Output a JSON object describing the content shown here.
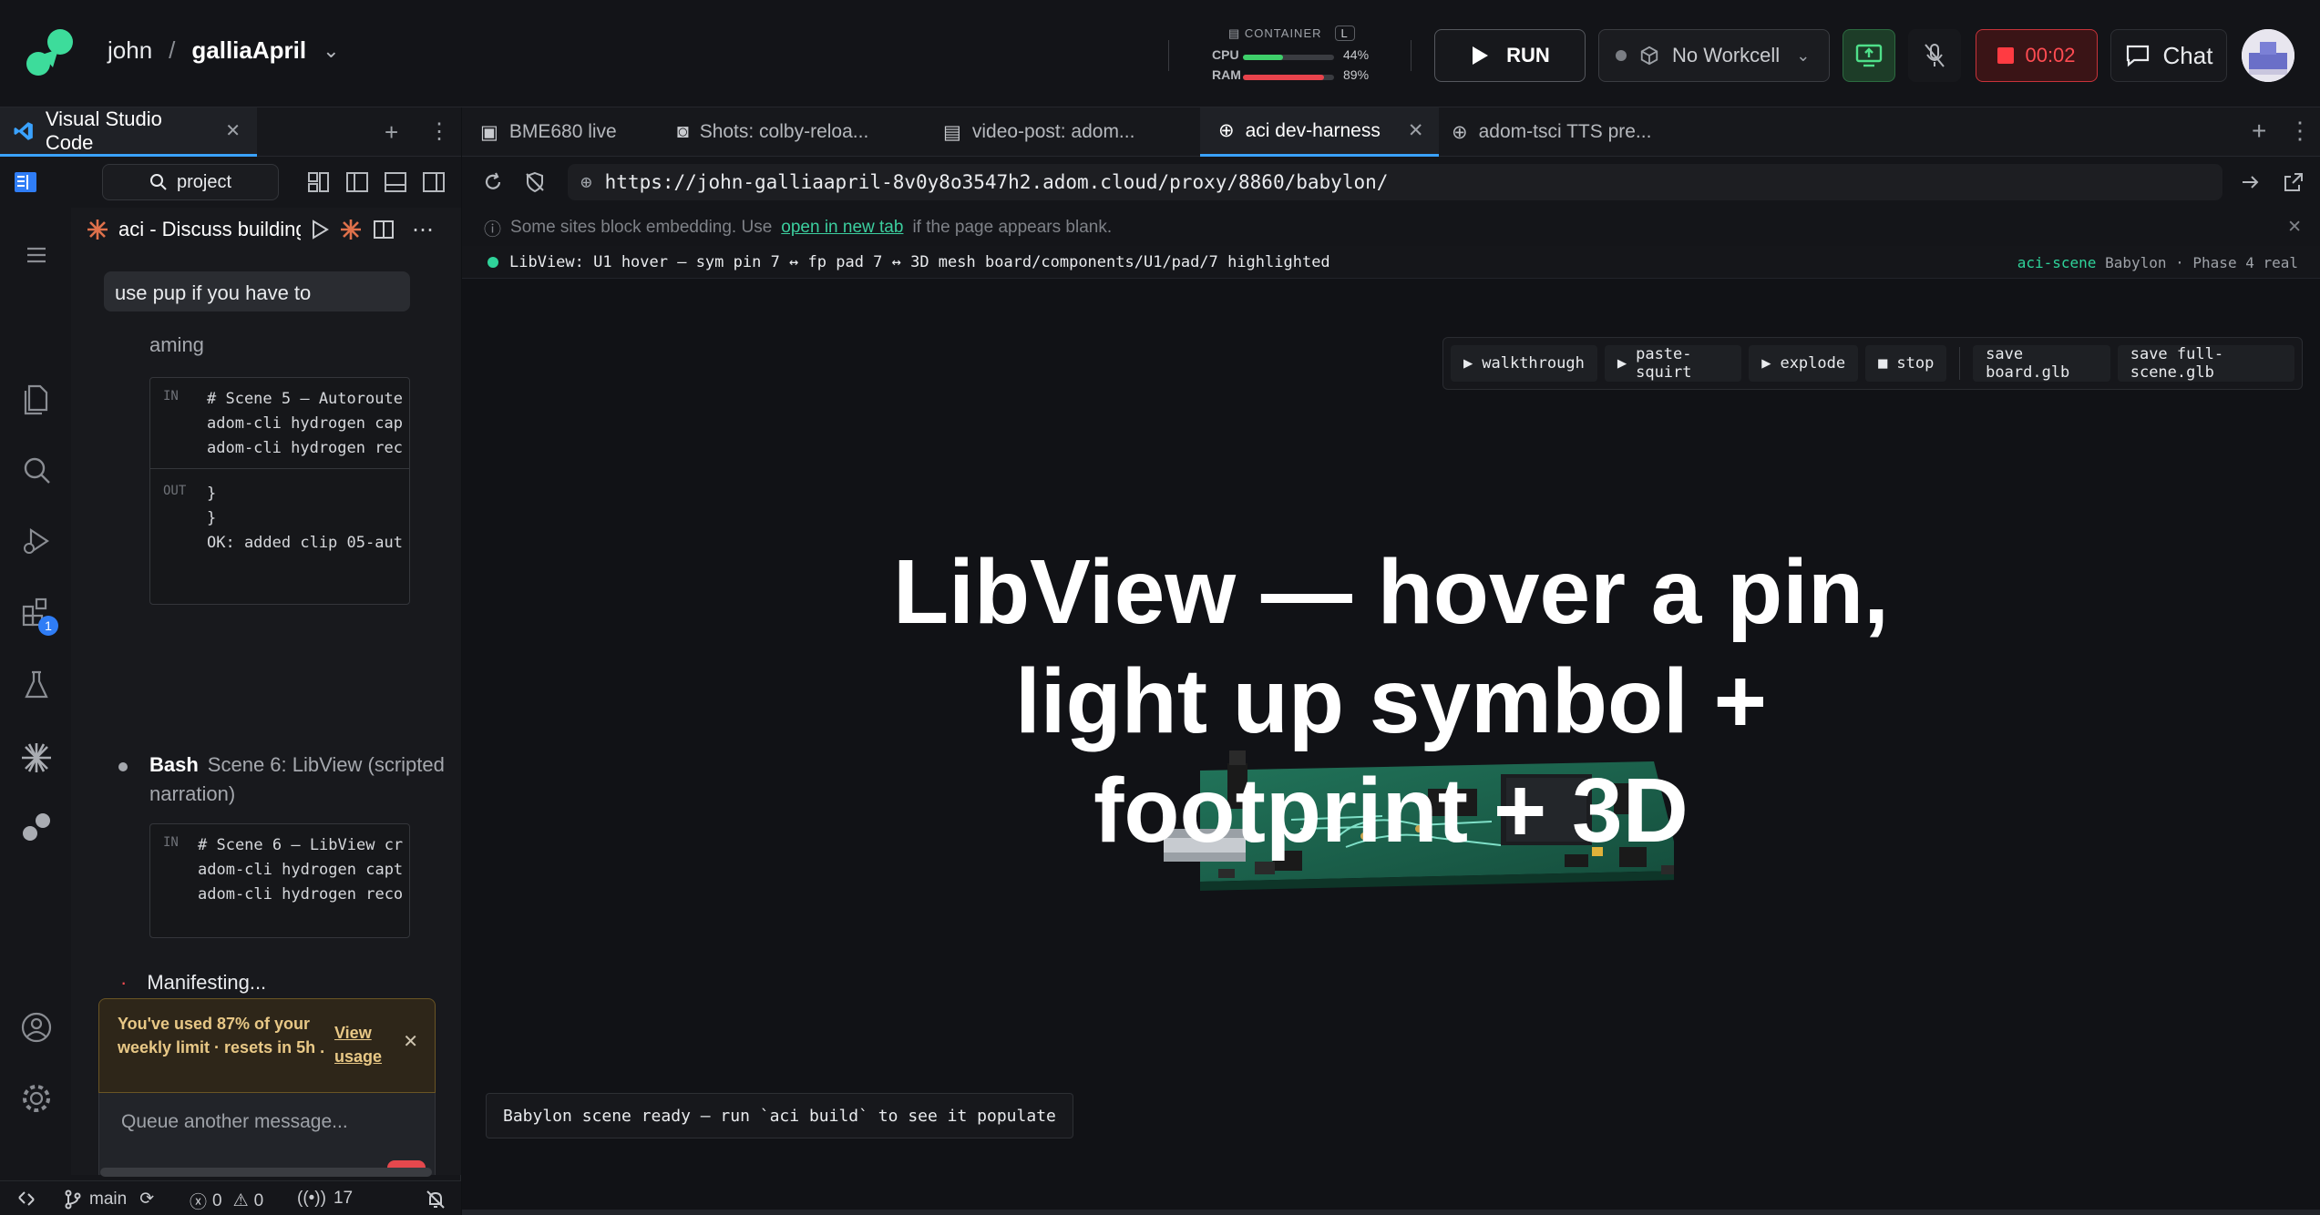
{
  "topbar": {
    "user": "john",
    "separator": "/",
    "project": "galliaApril",
    "resources": {
      "header": "CONTAINER",
      "size_badge": "L",
      "cpu_label": "CPU",
      "cpu_pct": "44%",
      "cpu_value": 44,
      "ram_label": "RAM",
      "ram_pct": "89%",
      "ram_value": 89
    },
    "run_label": "RUN",
    "workcell_label": "No Workcell",
    "timer": "00:02",
    "chat_label": "Chat"
  },
  "left": {
    "tab_label": "Visual Studio Code",
    "search_label": "project",
    "activity_badge": "1",
    "chat_title": "aci - Discuss building",
    "user_message": "use pup if you have to",
    "thinking_label": "aming",
    "code1": {
      "in_tag": "IN",
      "in_lines": "# Scene 5 — Autoroute\nadom-cli hydrogen cap\nadom-cli hydrogen rec",
      "out_tag": "OUT",
      "out_lines": "}\n}\nOK: added clip 05-aut"
    },
    "bash_tool": "Bash",
    "bash_desc": "Scene 6: LibView (scripted narration)",
    "code2": {
      "in_tag": "IN",
      "in_lines": "# Scene 6 — LibView cr\nadom-cli hydrogen capt\nadom-cli hydrogen reco"
    },
    "status_text": "Manifesting...",
    "limit_notice": "You've used 87% of your weekly limit · resets in 5h .",
    "limit_link": "View usage",
    "composer_placeholder": "Queue another message...",
    "statusbar": {
      "branch": "main",
      "errors": "0",
      "warnings": "0",
      "ports": "17"
    }
  },
  "browser": {
    "tabs": [
      {
        "label": "BME680 live"
      },
      {
        "label": "Shots: colby-reloa..."
      },
      {
        "label": "video-post: adom..."
      },
      {
        "label": "aci dev-harness"
      },
      {
        "label": "adom-tsci TTS pre..."
      }
    ],
    "url": "https://john-galliaapril-8v0y8o3547h2.adom.cloud/proxy/8860/babylon/",
    "notice_pre": "Some sites block embedding. Use",
    "notice_link": "open in new tab",
    "notice_post": "if the page appears blank.",
    "libview_status": "LibView: U1 hover — sym pin 7 ↔ fp pad 7 ↔ 3D mesh board/components/U1/pad/7 highlighted",
    "scene_tag": "aci-scene",
    "scene_info": "Babylon · Phase 4 real",
    "tools": {
      "walkthrough": "walkthrough",
      "paste_squirt": "paste-squirt",
      "explode": "explode",
      "stop": "stop",
      "save_board": "save board.glb",
      "save_scene": "save full-scene.glb"
    },
    "overlay_line1": "LibView — hover a pin,",
    "overlay_line2": "light up symbol +",
    "overlay_line3": "footprint + 3D",
    "ready_text": "Babylon scene ready — run `aci build` to see it populate"
  },
  "colors": {
    "accent_green": "#2fd39a",
    "record_red": "#ff3b42",
    "tab_active_blue": "#3aa2ff",
    "pcb_green": "#1f6b4e"
  }
}
